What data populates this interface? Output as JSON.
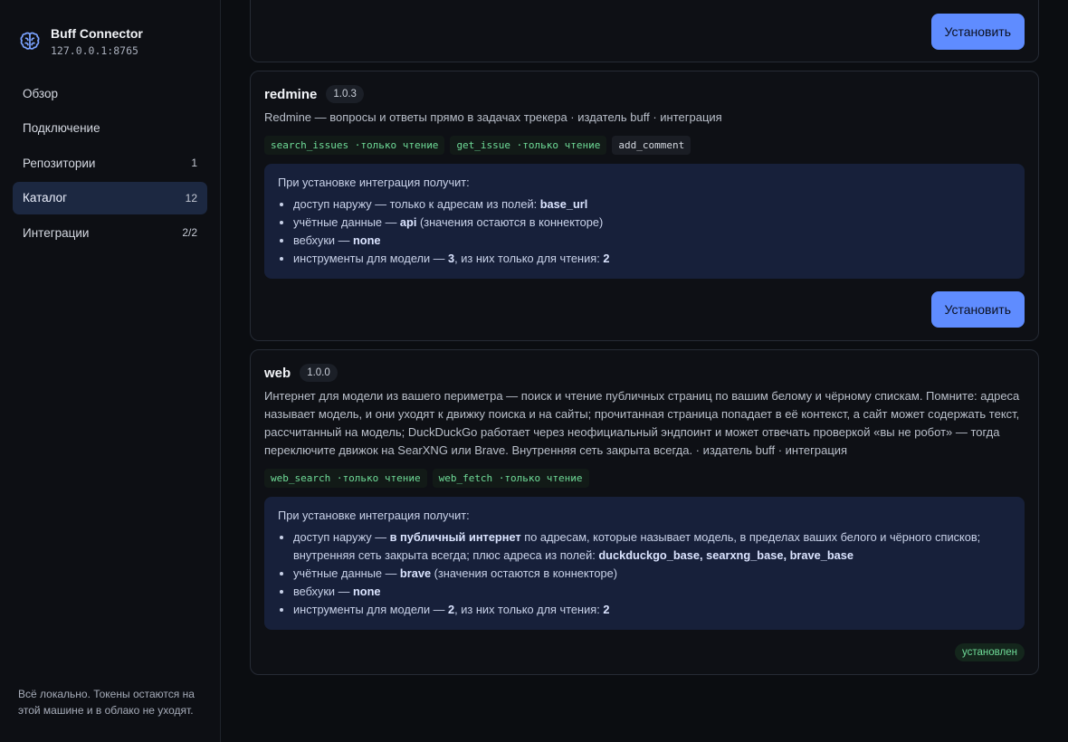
{
  "app": {
    "title": "Buff Connector",
    "address": "127.0.0.1:8765"
  },
  "nav": [
    {
      "label": "Обзор",
      "count": ""
    },
    {
      "label": "Подключение",
      "count": ""
    },
    {
      "label": "Репозитории",
      "count": "1"
    },
    {
      "label": "Каталог",
      "count": "12"
    },
    {
      "label": "Интеграции",
      "count": "2/2"
    }
  ],
  "footer": "Всё локально. Токены остаются на этой машине и в облако не уходят.",
  "install_label": "Установить",
  "installed_label": "установлен",
  "plugins": {
    "redmine": {
      "name": "redmine",
      "version": "1.0.3",
      "description": "Redmine — вопросы и ответы прямо в задачах трекера · издатель buff · интеграция",
      "tags": [
        {
          "name": "search_issues",
          "suffix": "·только чтение"
        },
        {
          "name": "get_issue",
          "suffix": "·только чтение"
        },
        {
          "name": "add_comment",
          "suffix": ""
        }
      ],
      "perm_head": "При установке интеграция получит:",
      "perm": {
        "net_prefix": "доступ наружу — только к адресам из полей: ",
        "net_value": "base_url",
        "cred_prefix": "учётные данные — ",
        "cred_value": "api",
        "cred_suffix": " (значения остаются в коннекторе)",
        "hooks_prefix": "вебхуки — ",
        "hooks_value": "none",
        "tools_prefix": "инструменты для модели — ",
        "tools_total": "3",
        "tools_mid": ", из них только для чтения: ",
        "tools_ro": "2"
      }
    },
    "web": {
      "name": "web",
      "version": "1.0.0",
      "description": "Интернет для модели из вашего периметра — поиск и чтение публичных страниц по вашим белому и чёрному спискам. Помните: адреса называет модель, и они уходят к движку поиска и на сайты; прочитанная страница попадает в её контекст, а сайт может содержать текст, рассчитанный на модель; DuckDuckGo работает через неофициальный эндпоинт и может отвечать проверкой «вы не робот» — тогда переключите движок на SearXNG или Brave. Внутренняя сеть закрыта всегда. · издатель buff · интеграция",
      "tags": [
        {
          "name": "web_search",
          "suffix": "·только чтение"
        },
        {
          "name": "web_fetch",
          "suffix": "·только чтение"
        }
      ],
      "perm_head": "При установке интеграция получит:",
      "perm": {
        "net_prefix": "доступ наружу — ",
        "net_bold": "в публичный интернет",
        "net_mid": " по адресам, которые называет модель, в пределах ваших белого и чёрного списков; внутренняя сеть закрыта всегда; плюс адреса из полей: ",
        "net_value": "duckduckgo_base, searxng_base, brave_base",
        "cred_prefix": "учётные данные — ",
        "cred_value": "brave",
        "cred_suffix": " (значения остаются в коннекторе)",
        "hooks_prefix": "вебхуки — ",
        "hooks_value": "none",
        "tools_prefix": "инструменты для модели — ",
        "tools_total": "2",
        "tools_mid": ", из них только для чтения: ",
        "tools_ro": "2"
      }
    }
  }
}
